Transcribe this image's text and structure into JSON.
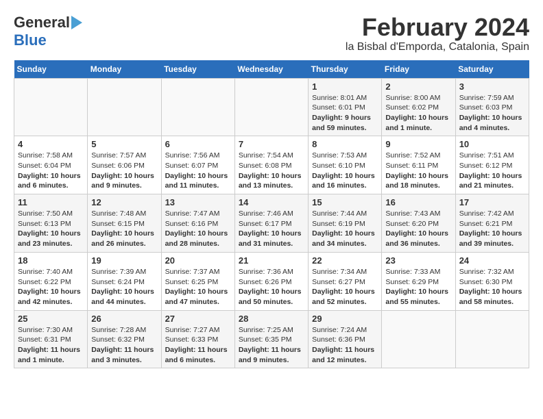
{
  "header": {
    "logo_line1": "General",
    "logo_line2": "Blue",
    "title": "February 2024",
    "subtitle": "la Bisbal d'Emporda, Catalonia, Spain"
  },
  "calendar": {
    "days_of_week": [
      "Sunday",
      "Monday",
      "Tuesday",
      "Wednesday",
      "Thursday",
      "Friday",
      "Saturday"
    ],
    "weeks": [
      [
        {
          "day": "",
          "info": ""
        },
        {
          "day": "",
          "info": ""
        },
        {
          "day": "",
          "info": ""
        },
        {
          "day": "",
          "info": ""
        },
        {
          "day": "1",
          "info": "Sunrise: 8:01 AM\nSunset: 6:01 PM\nDaylight: 9 hours and 59 minutes."
        },
        {
          "day": "2",
          "info": "Sunrise: 8:00 AM\nSunset: 6:02 PM\nDaylight: 10 hours and 1 minute."
        },
        {
          "day": "3",
          "info": "Sunrise: 7:59 AM\nSunset: 6:03 PM\nDaylight: 10 hours and 4 minutes."
        }
      ],
      [
        {
          "day": "4",
          "info": "Sunrise: 7:58 AM\nSunset: 6:04 PM\nDaylight: 10 hours and 6 minutes."
        },
        {
          "day": "5",
          "info": "Sunrise: 7:57 AM\nSunset: 6:06 PM\nDaylight: 10 hours and 9 minutes."
        },
        {
          "day": "6",
          "info": "Sunrise: 7:56 AM\nSunset: 6:07 PM\nDaylight: 10 hours and 11 minutes."
        },
        {
          "day": "7",
          "info": "Sunrise: 7:54 AM\nSunset: 6:08 PM\nDaylight: 10 hours and 13 minutes."
        },
        {
          "day": "8",
          "info": "Sunrise: 7:53 AM\nSunset: 6:10 PM\nDaylight: 10 hours and 16 minutes."
        },
        {
          "day": "9",
          "info": "Sunrise: 7:52 AM\nSunset: 6:11 PM\nDaylight: 10 hours and 18 minutes."
        },
        {
          "day": "10",
          "info": "Sunrise: 7:51 AM\nSunset: 6:12 PM\nDaylight: 10 hours and 21 minutes."
        }
      ],
      [
        {
          "day": "11",
          "info": "Sunrise: 7:50 AM\nSunset: 6:13 PM\nDaylight: 10 hours and 23 minutes."
        },
        {
          "day": "12",
          "info": "Sunrise: 7:48 AM\nSunset: 6:15 PM\nDaylight: 10 hours and 26 minutes."
        },
        {
          "day": "13",
          "info": "Sunrise: 7:47 AM\nSunset: 6:16 PM\nDaylight: 10 hours and 28 minutes."
        },
        {
          "day": "14",
          "info": "Sunrise: 7:46 AM\nSunset: 6:17 PM\nDaylight: 10 hours and 31 minutes."
        },
        {
          "day": "15",
          "info": "Sunrise: 7:44 AM\nSunset: 6:19 PM\nDaylight: 10 hours and 34 minutes."
        },
        {
          "day": "16",
          "info": "Sunrise: 7:43 AM\nSunset: 6:20 PM\nDaylight: 10 hours and 36 minutes."
        },
        {
          "day": "17",
          "info": "Sunrise: 7:42 AM\nSunset: 6:21 PM\nDaylight: 10 hours and 39 minutes."
        }
      ],
      [
        {
          "day": "18",
          "info": "Sunrise: 7:40 AM\nSunset: 6:22 PM\nDaylight: 10 hours and 42 minutes."
        },
        {
          "day": "19",
          "info": "Sunrise: 7:39 AM\nSunset: 6:24 PM\nDaylight: 10 hours and 44 minutes."
        },
        {
          "day": "20",
          "info": "Sunrise: 7:37 AM\nSunset: 6:25 PM\nDaylight: 10 hours and 47 minutes."
        },
        {
          "day": "21",
          "info": "Sunrise: 7:36 AM\nSunset: 6:26 PM\nDaylight: 10 hours and 50 minutes."
        },
        {
          "day": "22",
          "info": "Sunrise: 7:34 AM\nSunset: 6:27 PM\nDaylight: 10 hours and 52 minutes."
        },
        {
          "day": "23",
          "info": "Sunrise: 7:33 AM\nSunset: 6:29 PM\nDaylight: 10 hours and 55 minutes."
        },
        {
          "day": "24",
          "info": "Sunrise: 7:32 AM\nSunset: 6:30 PM\nDaylight: 10 hours and 58 minutes."
        }
      ],
      [
        {
          "day": "25",
          "info": "Sunrise: 7:30 AM\nSunset: 6:31 PM\nDaylight: 11 hours and 1 minute."
        },
        {
          "day": "26",
          "info": "Sunrise: 7:28 AM\nSunset: 6:32 PM\nDaylight: 11 hours and 3 minutes."
        },
        {
          "day": "27",
          "info": "Sunrise: 7:27 AM\nSunset: 6:33 PM\nDaylight: 11 hours and 6 minutes."
        },
        {
          "day": "28",
          "info": "Sunrise: 7:25 AM\nSunset: 6:35 PM\nDaylight: 11 hours and 9 minutes."
        },
        {
          "day": "29",
          "info": "Sunrise: 7:24 AM\nSunset: 6:36 PM\nDaylight: 11 hours and 12 minutes."
        },
        {
          "day": "",
          "info": ""
        },
        {
          "day": "",
          "info": ""
        }
      ]
    ]
  }
}
